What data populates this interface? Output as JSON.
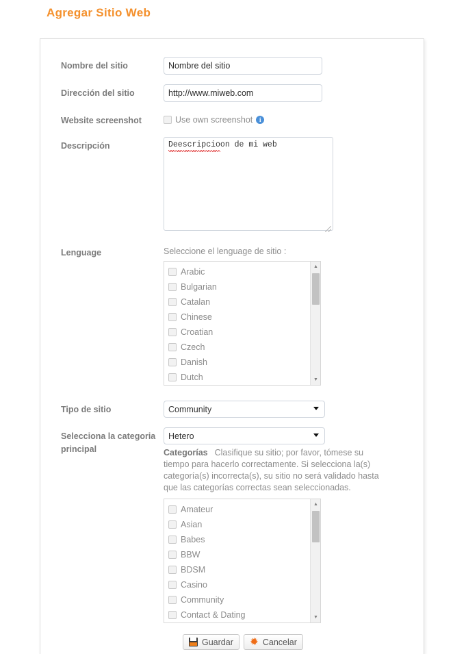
{
  "page": {
    "title": "Agregar Sitio Web",
    "accent_color": "#f4902c"
  },
  "form": {
    "site_name": {
      "label": "Nombre del sitio",
      "value": "Nombre del sitio",
      "placeholder": "Nombre del sitio"
    },
    "site_url": {
      "label": "Dirección del sitio",
      "value": "http://www.miweb.com",
      "placeholder": "http://www.miweb.com"
    },
    "screenshot": {
      "label": "Website screenshot",
      "checkbox_label": "Use own screenshot",
      "info_glyph": "i"
    },
    "description": {
      "label": "Descripción",
      "value": "Deescripcioon de mi web",
      "placeholder": ""
    },
    "language": {
      "label": "Lenguage",
      "hint": "Seleccione el lenguage de sitio :",
      "options": [
        "Arabic",
        "Bulgarian",
        "Catalan",
        "Chinese",
        "Croatian",
        "Czech",
        "Danish",
        "Dutch"
      ]
    },
    "site_type": {
      "label": "Tipo de sitio",
      "selected": "Community",
      "options": [
        "Community"
      ]
    },
    "main_category": {
      "label_line1": "Selecciona la categoria",
      "label_line2": "principal",
      "selected": "Hetero",
      "options": [
        "Hetero"
      ]
    },
    "categories": {
      "heading": "Categorías",
      "note": "Clasifique su sitio; por favor, tómese su tiempo para hacerlo correctamente. Si selecciona la(s) categoría(s) incorrecta(s), su sitio no será validado hasta que las categorías correctas sean seleccionadas.",
      "options": [
        "Amateur",
        "Asian",
        "Babes",
        "BBW",
        "BDSM",
        "Casino",
        "Community",
        "Contact & Dating"
      ]
    }
  },
  "actions": {
    "save_label": "Guardar",
    "cancel_label": "Cancelar",
    "cancel_glyph": "✹"
  }
}
